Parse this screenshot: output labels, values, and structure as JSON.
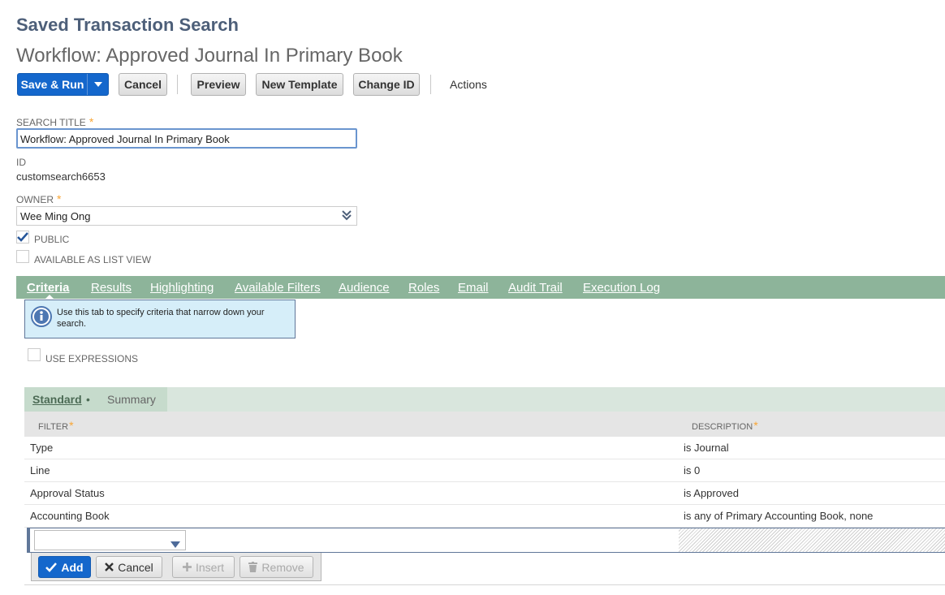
{
  "page": {
    "type_title": "Saved Transaction Search",
    "record_title": "Workflow: Approved Journal In Primary Book"
  },
  "toolbar": {
    "save_run": "Save & Run",
    "cancel": "Cancel",
    "preview": "Preview",
    "new_template": "New Template",
    "change_id": "Change ID",
    "actions": "Actions"
  },
  "form": {
    "search_title_label": "Search Title",
    "search_title_value": "Workflow: Approved Journal In Primary Book",
    "id_label": "ID",
    "id_value": "customsearch6653",
    "owner_label": "Owner",
    "owner_value": "Wee Ming Ong",
    "public_label": "Public",
    "public_checked": true,
    "list_view_label": "Available as List View",
    "list_view_checked": false,
    "required_mark": "*"
  },
  "tabs": [
    {
      "label": "Criteria",
      "active": true
    },
    {
      "label": "Results"
    },
    {
      "label": "Highlighting"
    },
    {
      "label": "Available Filters"
    },
    {
      "label": "Audience"
    },
    {
      "label": "Roles"
    },
    {
      "label": "Email"
    },
    {
      "label": "Audit Trail"
    },
    {
      "label": "Execution Log"
    }
  ],
  "criteria": {
    "help_text": "Use this tab to specify criteria that narrow down your search.",
    "use_expressions_label": "Use Expressions",
    "subtabs": [
      {
        "label": "Standard",
        "active": true,
        "bullet": "•"
      },
      {
        "label": "Summary"
      }
    ],
    "columns": {
      "filter": "Filter",
      "description": "Description"
    },
    "rows": [
      {
        "filter": "Type",
        "description": "is Journal"
      },
      {
        "filter": "Line",
        "description": "is 0"
      },
      {
        "filter": "Approval Status",
        "description": "is Approved"
      },
      {
        "filter": "Accounting Book",
        "description": "is any of Primary Accounting Book, none"
      }
    ],
    "buttons": {
      "add": "Add",
      "cancel": "Cancel",
      "insert": "Insert",
      "remove": "Remove"
    }
  },
  "colors": {
    "accent": "#1467cc",
    "tab_bar": "#8db49a",
    "header_text": "#4d5f79",
    "required": "#f8a535"
  }
}
